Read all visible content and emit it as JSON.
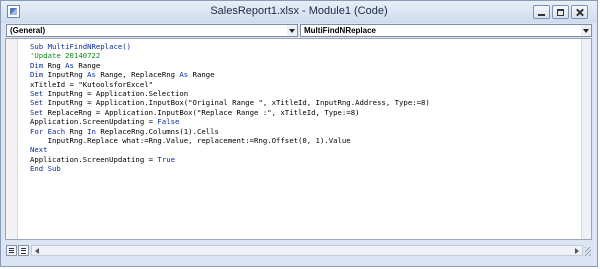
{
  "window": {
    "title": "SalesReport1.xlsx - Module1 (Code)"
  },
  "dropdowns": {
    "object_value": "(General)",
    "procedure_value": "MultiFindNReplace"
  },
  "code_lines": [
    [
      {
        "t": "Sub MultiFindNReplace()",
        "c": "kw"
      }
    ],
    [
      {
        "t": "'Update 20140722",
        "c": "cm"
      }
    ],
    [
      {
        "t": "Dim",
        "c": "kw"
      },
      {
        "t": " Rng ",
        "c": ""
      },
      {
        "t": "As",
        "c": "kw"
      },
      {
        "t": " Range",
        "c": ""
      }
    ],
    [
      {
        "t": "Dim",
        "c": "kw"
      },
      {
        "t": " InputRng ",
        "c": ""
      },
      {
        "t": "As",
        "c": "kw"
      },
      {
        "t": " Range, ReplaceRng ",
        "c": ""
      },
      {
        "t": "As",
        "c": "kw"
      },
      {
        "t": " Range",
        "c": ""
      }
    ],
    [
      {
        "t": "xTitleId = \"KutoolsforExcel\"",
        "c": ""
      }
    ],
    [
      {
        "t": "Set",
        "c": "kw"
      },
      {
        "t": " InputRng = Application.Selection",
        "c": ""
      }
    ],
    [
      {
        "t": "Set",
        "c": "kw"
      },
      {
        "t": " InputRng = Application.InputBox(\"Original Range \", xTitleId, InputRng.Address, Type:=8)",
        "c": ""
      }
    ],
    [
      {
        "t": "Set",
        "c": "kw"
      },
      {
        "t": " ReplaceRng = Application.InputBox(\"Replace Range :\", xTitleId, Type:=8)",
        "c": ""
      }
    ],
    [
      {
        "t": "Application.ScreenUpdating = ",
        "c": ""
      },
      {
        "t": "False",
        "c": "kw"
      }
    ],
    [
      {
        "t": "For Each",
        "c": "kw"
      },
      {
        "t": " Rng ",
        "c": ""
      },
      {
        "t": "In",
        "c": "kw"
      },
      {
        "t": " ReplaceRng.Columns(1).Cells",
        "c": ""
      }
    ],
    [
      {
        "t": "    InputRng.Replace what:=Rng.Value, replacement:=Rng.Offset(0, 1).Value",
        "c": ""
      }
    ],
    [
      {
        "t": "Next",
        "c": "kw"
      }
    ],
    [
      {
        "t": "Application.ScreenUpdating = ",
        "c": ""
      },
      {
        "t": "True",
        "c": "kw"
      }
    ],
    [
      {
        "t": "End Sub",
        "c": "kw"
      }
    ]
  ],
  "icons": {
    "app": "vba-module-icon",
    "minimize": "minimize-icon",
    "maximize": "maximize-icon",
    "close": "close-icon"
  }
}
